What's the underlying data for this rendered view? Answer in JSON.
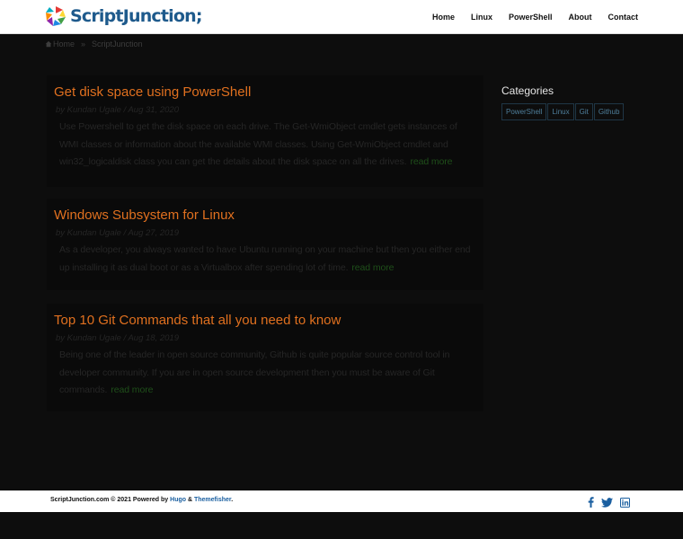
{
  "header": {
    "logo_text": "ScriptJunction;",
    "nav": [
      "Home",
      "Linux",
      "PowerShell",
      "About",
      "Contact"
    ]
  },
  "breadcrumb": {
    "home": "Home",
    "separator": "»",
    "current": "ScriptJunction"
  },
  "posts": [
    {
      "title": "Get disk space using PowerShell",
      "meta": "by Kundan Ugale / Aug 31, 2020",
      "excerpt": "Use Powershell to get the disk space on each drive. The Get-WmiObject cmdlet gets instances of WMI classes or information about the available WMI classes. Using Get-WmiObject cmdlet and win32_logicaldisk class you can get the details about the disk space on all the drives.",
      "read_more": "read more"
    },
    {
      "title": "Windows Subsystem for Linux",
      "meta": "by Kundan Ugale / Aug 27, 2019",
      "excerpt": "As a developer, you always wanted to have Ubuntu running on your machine but then you either end up installing it as dual boot or as a Virtualbox after spending lot of time.",
      "read_more": "read more"
    },
    {
      "title": "Top 10 Git Commands that all you need to know",
      "meta": "by Kundan Ugale / Aug 18, 2019",
      "excerpt": "Being one of the leader in open source community, Github is quite popular source control tool in developer community. If you are in open source development then you must be aware of Git commands.",
      "read_more": "read more"
    }
  ],
  "sidebar": {
    "title": "Categories",
    "tags": [
      "PowerShell",
      "Linux",
      "Git",
      "Github"
    ]
  },
  "footer": {
    "text_before": "ScriptJunction.com © 2021 Powered by ",
    "hugo": "Hugo",
    "amp": " & ",
    "themefisher": "Themefisher",
    "period": ".",
    "social_icons": [
      "facebook-icon",
      "twitter-icon",
      "linkedin-icon"
    ]
  },
  "colors": {
    "accent_orange": "#e0701f",
    "brand_blue": "#1e5a8c",
    "link_blue": "#1a5fa0"
  }
}
